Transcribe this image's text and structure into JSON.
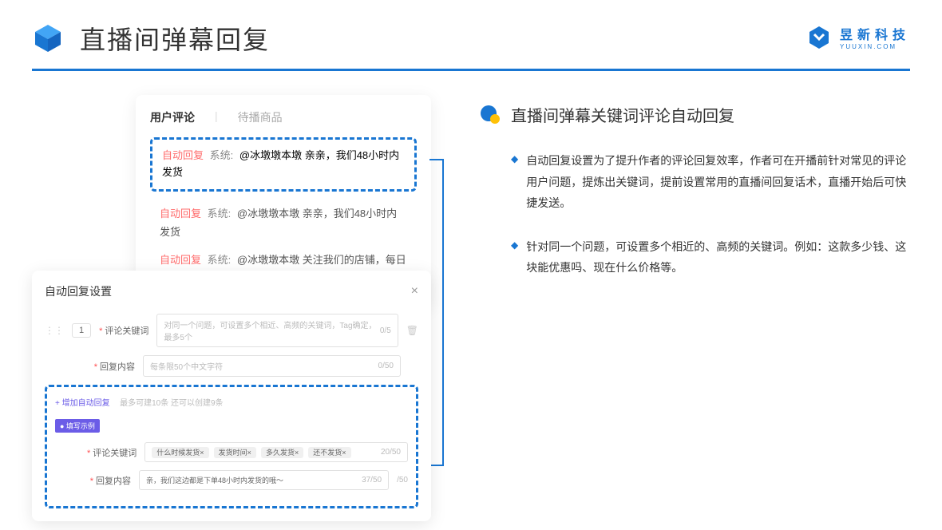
{
  "header": {
    "title": "直播间弹幕回复"
  },
  "brand": {
    "name": "昱新科技",
    "url": "YUUXIN.COM"
  },
  "card1": {
    "tab1": "用户评论",
    "tab2": "待播商品",
    "hl_tag": "自动回复",
    "hl_sys": "系统:",
    "hl_msg": "@冰墩墩本墩 亲亲，我们48小时内发货",
    "c2_tag": "自动回复",
    "c2_sys": "系统:",
    "c2_msg": "@冰墩墩本墩 亲亲，我们48小时内发货",
    "c3_tag": "自动回复",
    "c3_sys": "系统:",
    "c3_msg": "@冰墩墩本墩 关注我们的店铺，每日都有热门推荐呦～"
  },
  "card2": {
    "title": "自动回复设置",
    "num": "1",
    "label1": "评论关键词",
    "ph1": "对同一个问题，可设置多个相近、高频的关键词，Tag确定，最多5个",
    "cnt1": "0/5",
    "label2": "回复内容",
    "ph2": "每条限50个中文字符",
    "cnt2": "0/50",
    "add": "+ 增加自动回复",
    "hint": "最多可建10条 还可以创建9条",
    "ex_tag": "● 填写示例",
    "ex_label1": "评论关键词",
    "t1": "什么时候发货×",
    "t2": "发货时间×",
    "t3": "多久发货×",
    "t4": "还不发货×",
    "ex_cnt1": "20/50",
    "ex_label2": "回复内容",
    "ex_val": "亲，我们这边都是下单48小时内发货的哦～",
    "ex_cnt2": "37/50",
    "ex_cnt3": "/50"
  },
  "right": {
    "title": "直播间弹幕关键词评论自动回复",
    "b1": "自动回复设置为了提升作者的评论回复效率，作者可在开播前针对常见的评论用户问题，提炼出关键词，提前设置常用的直播间回复话术，直播开始后可快捷发送。",
    "b2": "针对同一个问题，可设置多个相近的、高频的关键词。例如：这款多少钱、这块能优惠吗、现在什么价格等。"
  }
}
